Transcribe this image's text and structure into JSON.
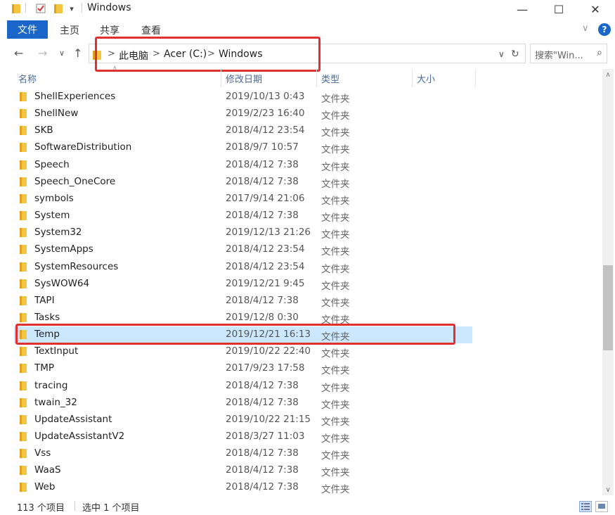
{
  "window": {
    "title": "Windows",
    "minimize_glyph": "—",
    "maximize_glyph": "☐",
    "close_glyph": "✕",
    "qa_dropdown_glyph": "▾"
  },
  "ribbon": {
    "tabs": [
      "文件",
      "主页",
      "共享",
      "查看"
    ],
    "help_glyph": "?",
    "collapse_glyph": "∨"
  },
  "nav": {
    "back_glyph": "←",
    "forward_glyph": "→",
    "recent_glyph": "∨",
    "up_glyph": "↑",
    "breadcrumbs": [
      "此电脑",
      "Acer (C:)",
      "Windows"
    ],
    "sep_glyph": ">",
    "dropdown_glyph": "∨",
    "refresh_glyph": "↻",
    "search_placeholder": "搜索\"Win...",
    "search_glyph": "⌕"
  },
  "columns": [
    "名称",
    "修改日期",
    "类型",
    "大小"
  ],
  "files": [
    {
      "name": "ShellExperiences",
      "date": "2019/10/13 0:43",
      "type": "文件夹"
    },
    {
      "name": "ShellNew",
      "date": "2019/2/23 16:40",
      "type": "文件夹"
    },
    {
      "name": "SKB",
      "date": "2018/4/12 23:54",
      "type": "文件夹"
    },
    {
      "name": "SoftwareDistribution",
      "date": "2018/9/7 10:57",
      "type": "文件夹"
    },
    {
      "name": "Speech",
      "date": "2018/4/12 7:38",
      "type": "文件夹"
    },
    {
      "name": "Speech_OneCore",
      "date": "2018/4/12 7:38",
      "type": "文件夹"
    },
    {
      "name": "symbols",
      "date": "2017/9/14 21:06",
      "type": "文件夹"
    },
    {
      "name": "System",
      "date": "2018/4/12 7:38",
      "type": "文件夹"
    },
    {
      "name": "System32",
      "date": "2019/12/13 21:26",
      "type": "文件夹"
    },
    {
      "name": "SystemApps",
      "date": "2018/4/12 23:54",
      "type": "文件夹"
    },
    {
      "name": "SystemResources",
      "date": "2018/4/12 23:54",
      "type": "文件夹"
    },
    {
      "name": "SysWOW64",
      "date": "2019/12/21 9:45",
      "type": "文件夹"
    },
    {
      "name": "TAPI",
      "date": "2018/4/12 7:38",
      "type": "文件夹"
    },
    {
      "name": "Tasks",
      "date": "2019/12/8 0:30",
      "type": "文件夹"
    },
    {
      "name": "Temp",
      "date": "2019/12/21 16:13",
      "type": "文件夹",
      "selected": true
    },
    {
      "name": "TextInput",
      "date": "2019/10/22 22:40",
      "type": "文件夹"
    },
    {
      "name": "TMP",
      "date": "2017/9/23 17:58",
      "type": "文件夹"
    },
    {
      "name": "tracing",
      "date": "2018/4/12 7:38",
      "type": "文件夹"
    },
    {
      "name": "twain_32",
      "date": "2018/4/12 7:38",
      "type": "文件夹"
    },
    {
      "name": "UpdateAssistant",
      "date": "2019/10/22 21:15",
      "type": "文件夹"
    },
    {
      "name": "UpdateAssistantV2",
      "date": "2018/3/27 11:03",
      "type": "文件夹"
    },
    {
      "name": "Vss",
      "date": "2018/4/12 7:38",
      "type": "文件夹"
    },
    {
      "name": "WaaS",
      "date": "2018/4/12 7:38",
      "type": "文件夹"
    },
    {
      "name": "Web",
      "date": "2018/4/12 7:38",
      "type": "文件夹"
    }
  ],
  "scrollbar": {
    "position_fraction": 0.58,
    "visible_fraction": 0.21,
    "up_glyph": "∧",
    "down_glyph": "∨"
  },
  "status": {
    "item_count": "113 个项目",
    "selected_count": "选中 1 个项目"
  },
  "colors": {
    "accent": "#1a66c9",
    "selection": "#cce8ff",
    "highlight_box": "#e03030",
    "folder": "#f4c542"
  }
}
